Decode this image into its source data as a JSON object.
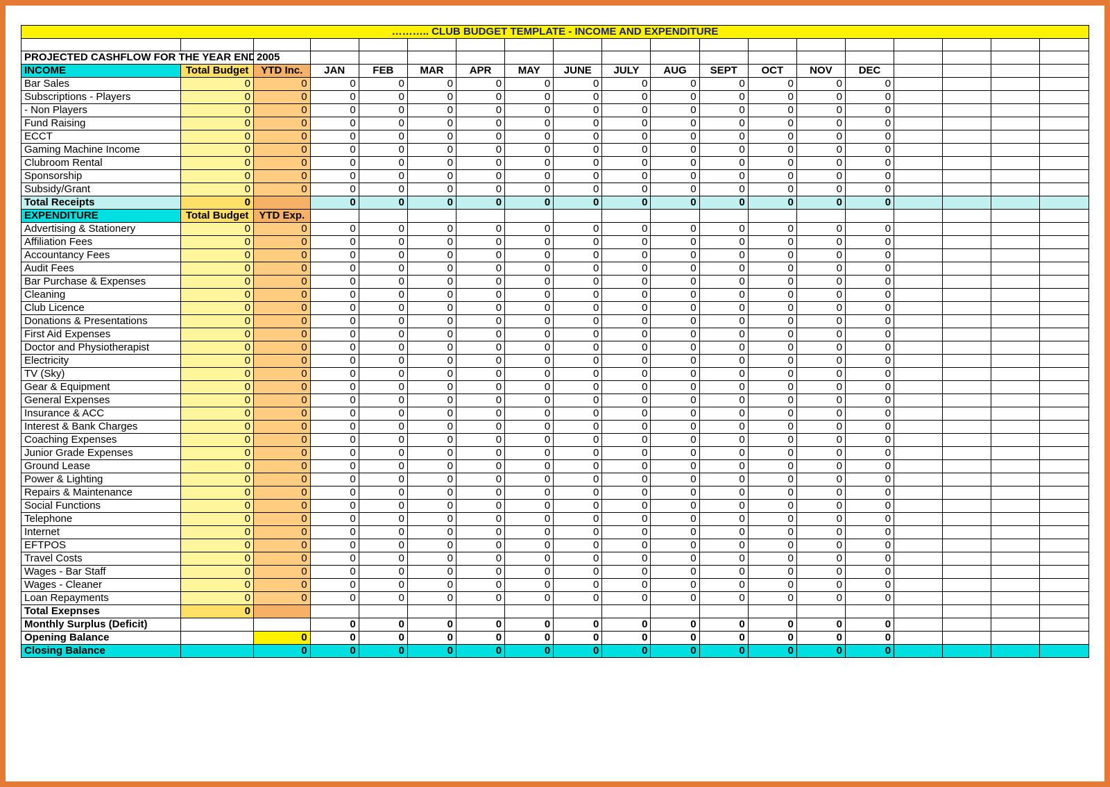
{
  "title": "………..  CLUB BUDGET TEMPLATE - INCOME AND EXPENDITURE",
  "subtitle_prefix": "PROJECTED CASHFLOW FOR THE YEAR ENDED",
  "subtitle_year": "2005",
  "headers": {
    "income_label": "INCOME",
    "expenditure_label": "EXPENDITURE",
    "total_budget": "Total Budget",
    "ytd_inc": "YTD Inc.",
    "ytd_exp": "YTD Exp.",
    "months": [
      "JAN",
      "FEB",
      "MAR",
      "APR",
      "MAY",
      "JUNE",
      "JULY",
      "AUG",
      "SEPT",
      "OCT",
      "NOV",
      "DEC"
    ]
  },
  "income_rows": [
    {
      "label": "Bar Sales",
      "budget": 0,
      "ytd": 0,
      "months": [
        0,
        0,
        0,
        0,
        0,
        0,
        0,
        0,
        0,
        0,
        0,
        0
      ]
    },
    {
      "label": "Subscriptions - Players",
      "budget": 0,
      "ytd": 0,
      "months": [
        0,
        0,
        0,
        0,
        0,
        0,
        0,
        0,
        0,
        0,
        0,
        0
      ]
    },
    {
      "label": "               - Non Players",
      "budget": 0,
      "ytd": 0,
      "months": [
        0,
        0,
        0,
        0,
        0,
        0,
        0,
        0,
        0,
        0,
        0,
        0
      ]
    },
    {
      "label": "Fund Raising",
      "budget": 0,
      "ytd": 0,
      "months": [
        0,
        0,
        0,
        0,
        0,
        0,
        0,
        0,
        0,
        0,
        0,
        0
      ]
    },
    {
      "label": "ECCT",
      "budget": 0,
      "ytd": 0,
      "months": [
        0,
        0,
        0,
        0,
        0,
        0,
        0,
        0,
        0,
        0,
        0,
        0
      ]
    },
    {
      "label": "Gaming Machine Income",
      "budget": 0,
      "ytd": 0,
      "months": [
        0,
        0,
        0,
        0,
        0,
        0,
        0,
        0,
        0,
        0,
        0,
        0
      ]
    },
    {
      "label": "Clubroom Rental",
      "budget": 0,
      "ytd": 0,
      "months": [
        0,
        0,
        0,
        0,
        0,
        0,
        0,
        0,
        0,
        0,
        0,
        0
      ]
    },
    {
      "label": "Sponsorship",
      "budget": 0,
      "ytd": 0,
      "months": [
        0,
        0,
        0,
        0,
        0,
        0,
        0,
        0,
        0,
        0,
        0,
        0
      ]
    },
    {
      "label": "Subsidy/Grant",
      "budget": 0,
      "ytd": 0,
      "months": [
        0,
        0,
        0,
        0,
        0,
        0,
        0,
        0,
        0,
        0,
        0,
        0
      ]
    }
  ],
  "total_receipts": {
    "label": "Total Receipts",
    "budget": 0,
    "ytd": "",
    "months": [
      0,
      0,
      0,
      0,
      0,
      0,
      0,
      0,
      0,
      0,
      0,
      0
    ]
  },
  "expenditure_rows": [
    {
      "label": "Advertising & Stationery",
      "budget": 0,
      "ytd": 0,
      "months": [
        0,
        0,
        0,
        0,
        0,
        0,
        0,
        0,
        0,
        0,
        0,
        0
      ]
    },
    {
      "label": "Affiliation Fees",
      "budget": 0,
      "ytd": 0,
      "months": [
        0,
        0,
        0,
        0,
        0,
        0,
        0,
        0,
        0,
        0,
        0,
        0
      ]
    },
    {
      "label": "Accountancy Fees",
      "budget": 0,
      "ytd": 0,
      "months": [
        0,
        0,
        0,
        0,
        0,
        0,
        0,
        0,
        0,
        0,
        0,
        0
      ]
    },
    {
      "label": "Audit Fees",
      "budget": 0,
      "ytd": 0,
      "months": [
        0,
        0,
        0,
        0,
        0,
        0,
        0,
        0,
        0,
        0,
        0,
        0
      ]
    },
    {
      "label": "Bar Purchase & Expenses",
      "budget": 0,
      "ytd": 0,
      "months": [
        0,
        0,
        0,
        0,
        0,
        0,
        0,
        0,
        0,
        0,
        0,
        0
      ]
    },
    {
      "label": "Cleaning",
      "budget": 0,
      "ytd": 0,
      "months": [
        0,
        0,
        0,
        0,
        0,
        0,
        0,
        0,
        0,
        0,
        0,
        0
      ]
    },
    {
      "label": "Club Licence",
      "budget": 0,
      "ytd": 0,
      "months": [
        0,
        0,
        0,
        0,
        0,
        0,
        0,
        0,
        0,
        0,
        0,
        0
      ]
    },
    {
      "label": "Donations & Presentations",
      "budget": 0,
      "ytd": 0,
      "months": [
        0,
        0,
        0,
        0,
        0,
        0,
        0,
        0,
        0,
        0,
        0,
        0
      ]
    },
    {
      "label": "First Aid Expenses",
      "budget": 0,
      "ytd": 0,
      "months": [
        0,
        0,
        0,
        0,
        0,
        0,
        0,
        0,
        0,
        0,
        0,
        0
      ]
    },
    {
      "label": "Doctor and Physiotherapist",
      "budget": 0,
      "ytd": 0,
      "months": [
        0,
        0,
        0,
        0,
        0,
        0,
        0,
        0,
        0,
        0,
        0,
        0
      ]
    },
    {
      "label": "Electricity",
      "budget": 0,
      "ytd": 0,
      "months": [
        0,
        0,
        0,
        0,
        0,
        0,
        0,
        0,
        0,
        0,
        0,
        0
      ]
    },
    {
      "label": "TV (Sky)",
      "budget": 0,
      "ytd": 0,
      "months": [
        0,
        0,
        0,
        0,
        0,
        0,
        0,
        0,
        0,
        0,
        0,
        0
      ]
    },
    {
      "label": "Gear & Equipment",
      "budget": 0,
      "ytd": 0,
      "months": [
        0,
        0,
        0,
        0,
        0,
        0,
        0,
        0,
        0,
        0,
        0,
        0
      ]
    },
    {
      "label": "General Expenses",
      "budget": 0,
      "ytd": 0,
      "months": [
        0,
        0,
        0,
        0,
        0,
        0,
        0,
        0,
        0,
        0,
        0,
        0
      ]
    },
    {
      "label": "Insurance & ACC",
      "budget": 0,
      "ytd": 0,
      "months": [
        0,
        0,
        0,
        0,
        0,
        0,
        0,
        0,
        0,
        0,
        0,
        0
      ]
    },
    {
      "label": "Interest & Bank Charges",
      "budget": 0,
      "ytd": 0,
      "months": [
        0,
        0,
        0,
        0,
        0,
        0,
        0,
        0,
        0,
        0,
        0,
        0
      ]
    },
    {
      "label": "Coaching Expenses",
      "budget": 0,
      "ytd": 0,
      "months": [
        0,
        0,
        0,
        0,
        0,
        0,
        0,
        0,
        0,
        0,
        0,
        0
      ]
    },
    {
      "label": "Junior Grade Expenses",
      "budget": 0,
      "ytd": 0,
      "months": [
        0,
        0,
        0,
        0,
        0,
        0,
        0,
        0,
        0,
        0,
        0,
        0
      ]
    },
    {
      "label": "Ground Lease",
      "budget": 0,
      "ytd": 0,
      "months": [
        0,
        0,
        0,
        0,
        0,
        0,
        0,
        0,
        0,
        0,
        0,
        0
      ]
    },
    {
      "label": "Power & Lighting",
      "budget": 0,
      "ytd": 0,
      "months": [
        0,
        0,
        0,
        0,
        0,
        0,
        0,
        0,
        0,
        0,
        0,
        0
      ]
    },
    {
      "label": "Repairs & Maintenance",
      "budget": 0,
      "ytd": 0,
      "months": [
        0,
        0,
        0,
        0,
        0,
        0,
        0,
        0,
        0,
        0,
        0,
        0
      ]
    },
    {
      "label": "Social Functions",
      "budget": 0,
      "ytd": 0,
      "months": [
        0,
        0,
        0,
        0,
        0,
        0,
        0,
        0,
        0,
        0,
        0,
        0
      ]
    },
    {
      "label": "Telephone",
      "budget": 0,
      "ytd": 0,
      "months": [
        0,
        0,
        0,
        0,
        0,
        0,
        0,
        0,
        0,
        0,
        0,
        0
      ]
    },
    {
      "label": "Internet",
      "budget": 0,
      "ytd": 0,
      "months": [
        0,
        0,
        0,
        0,
        0,
        0,
        0,
        0,
        0,
        0,
        0,
        0
      ]
    },
    {
      "label": "EFTPOS",
      "budget": 0,
      "ytd": 0,
      "months": [
        0,
        0,
        0,
        0,
        0,
        0,
        0,
        0,
        0,
        0,
        0,
        0
      ]
    },
    {
      "label": "Travel Costs",
      "budget": 0,
      "ytd": 0,
      "months": [
        0,
        0,
        0,
        0,
        0,
        0,
        0,
        0,
        0,
        0,
        0,
        0
      ]
    },
    {
      "label": "Wages - Bar Staff",
      "budget": 0,
      "ytd": 0,
      "months": [
        0,
        0,
        0,
        0,
        0,
        0,
        0,
        0,
        0,
        0,
        0,
        0
      ]
    },
    {
      "label": "Wages - Cleaner",
      "budget": 0,
      "ytd": 0,
      "months": [
        0,
        0,
        0,
        0,
        0,
        0,
        0,
        0,
        0,
        0,
        0,
        0
      ]
    },
    {
      "label": "Loan Repayments",
      "budget": 0,
      "ytd": 0,
      "months": [
        0,
        0,
        0,
        0,
        0,
        0,
        0,
        0,
        0,
        0,
        0,
        0
      ]
    }
  ],
  "total_expenses": {
    "label": "Total  Exepnses",
    "budget": 0,
    "ytd": "",
    "months": [
      "",
      "",
      "",
      "",
      "",
      "",
      "",
      "",
      "",
      "",
      "",
      ""
    ]
  },
  "monthly_surplus": {
    "label": "Monthly Surplus (Deficit)",
    "budget": "",
    "ytd": "",
    "months": [
      0,
      0,
      0,
      0,
      0,
      0,
      0,
      0,
      0,
      0,
      0,
      0
    ]
  },
  "opening_balance": {
    "label": "Opening Balance",
    "budget": "",
    "ytd": 0,
    "months": [
      0,
      0,
      0,
      0,
      0,
      0,
      0,
      0,
      0,
      0,
      0,
      0
    ]
  },
  "closing_balance": {
    "label": "Closing Balance",
    "budget": "",
    "ytd": 0,
    "months": [
      0,
      0,
      0,
      0,
      0,
      0,
      0,
      0,
      0,
      0,
      0,
      0
    ]
  }
}
